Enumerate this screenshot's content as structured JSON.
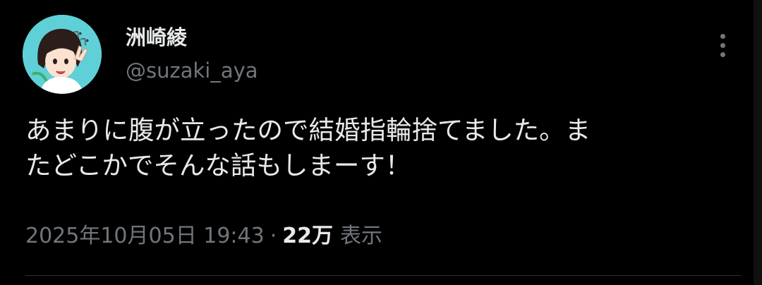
{
  "author": {
    "display_name": "洲崎綾",
    "handle": "@suzaki_aya",
    "avatar_icon": "avatar-illustration-icon"
  },
  "tweet": {
    "text_line_1": "あまりに腹が立ったので結婚指輪捨てました。ま",
    "text_line_2": "たどこかでそんな話もしまーす！",
    "timestamp": "2025年10月05日 19:43",
    "separator": "·",
    "views_count": "22万",
    "views_label": "表示"
  },
  "colors": {
    "background": "#000000",
    "primary_text": "#e7e9ea",
    "secondary_text": "#71767b",
    "divider": "#2f3336",
    "avatar_bg": "#5fd0d8"
  },
  "icons": {
    "more": "more-vertical-icon"
  }
}
